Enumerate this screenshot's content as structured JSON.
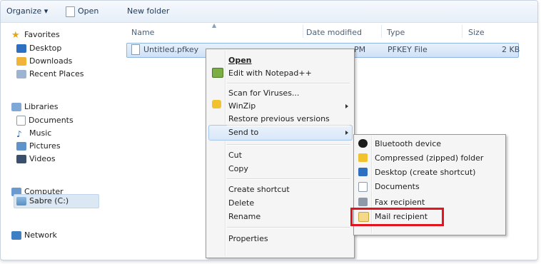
{
  "toolbar": {
    "organize": "Organize ▾",
    "open": "Open",
    "new_folder": "New folder"
  },
  "sidebar": {
    "favorites": "Favorites",
    "favorites_items": [
      "Desktop",
      "Downloads",
      "Recent Places"
    ],
    "libraries": "Libraries",
    "libraries_items": [
      "Documents",
      "Music",
      "Pictures",
      "Videos"
    ],
    "computer": "Computer",
    "computer_items": [
      "Sabre (C:)"
    ],
    "network": "Network"
  },
  "columns": {
    "name": "Name",
    "date_modified": "Date modified",
    "type": "Type",
    "size": "Size"
  },
  "file": {
    "name": "Untitled.pfkey",
    "date_fragment": "PM",
    "type": "PFKEY File",
    "size": "2 KB"
  },
  "context_menu": {
    "open": "Open",
    "edit_notepad": "Edit with Notepad++",
    "scan": "Scan for Viruses...",
    "winzip": "WinZip",
    "restore": "Restore previous versions",
    "send_to": "Send to",
    "cut": "Cut",
    "copy": "Copy",
    "create_shortcut": "Create shortcut",
    "delete": "Delete",
    "rename": "Rename",
    "properties": "Properties"
  },
  "send_to_menu": {
    "bluetooth": "Bluetooth device",
    "compressed": "Compressed (zipped) folder",
    "desktop": "Desktop (create shortcut)",
    "documents": "Documents",
    "fax": "Fax recipient",
    "mail": "Mail recipient"
  },
  "colors": {
    "highlight_box": "#e3141d",
    "selection": "#cfe1f7"
  }
}
